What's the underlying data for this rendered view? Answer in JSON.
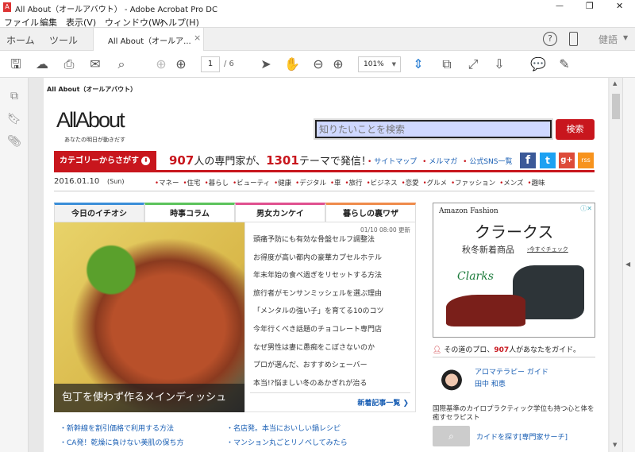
{
  "window": {
    "title": "All About（オールアバウト） - Adobe Acrobat Pro DC",
    "minimize": "—",
    "restore": "❐",
    "close": "✕"
  },
  "menu": [
    "ファイル",
    "編集",
    "表示(V)",
    "ウィンドウ(W)",
    "ヘルプ(H)"
  ],
  "tabs": {
    "home": "ホーム",
    "tools": "ツール",
    "doc": "All About（オールア...",
    "close": "×",
    "lang": "健語"
  },
  "toolbar": {
    "page_current": "1",
    "page_total": "/ 6",
    "zoom": "101%"
  },
  "page": {
    "header_text": "All About（オールアバウト）",
    "logo": "AllAbout",
    "tagline": "あなたの明日が動きだす",
    "search_placeholder": "知りたいことを検索",
    "search_button": "検索",
    "category_button": "カテゴリーからさがす",
    "experts_count": "907",
    "experts_text": "人の専門家が、",
    "themes_count": "1301",
    "themes_text": "テーマで発信！",
    "links": [
      "サイトマップ",
      "メルマガ",
      "公式SNS一覧"
    ],
    "social": [
      "f",
      "t",
      "g+",
      "rss"
    ],
    "date": "2016.01.10",
    "day": "(Sun)",
    "categories": [
      "マネー",
      "住宅",
      "暮らし",
      "ビューティ",
      "健康",
      "デジタル",
      "車",
      "旅行",
      "ビジネス",
      "恋愛",
      "グルメ",
      "ファッション",
      "メンズ",
      "趣味"
    ],
    "section_tabs": [
      {
        "label": "今日のイチオシ",
        "color": "#3a8ed8"
      },
      {
        "label": "時事コラム",
        "color": "#5cc35c"
      },
      {
        "label": "男女カンケイ",
        "color": "#e0508f"
      },
      {
        "label": "暮らしの裏ワザ",
        "color": "#ef8b4b"
      }
    ],
    "feature_caption": "包丁を使わず作るメインディッシュ",
    "updated": "01/10 08:00 更新",
    "headlines": [
      "頭痛予防にも有効な骨盤セルフ調整法",
      "お得度が高い都内の豪華カプセルホテル",
      "年末年始の食べ過ぎをリセットする方法",
      "旅行者がモンサンミッシェルを選ぶ理由",
      "「メンタルの強い子」を育てる10のコツ",
      "今年行くべき話題のチョコレート専門店",
      "なぜ男性は妻に愚痴をこぼさないのか",
      "プロが選んだ、おすすめシェーバー",
      "本当!?悩ましい冬のあかぎれが治る"
    ],
    "more_articles": "新着記事一覧 ❯",
    "bottom_links": [
      "新幹線を割引価格で利用する方法",
      "名店発。本当においしい鍋レシピ",
      "CA発！乾燥に負けない美肌の保ち方",
      "マンション丸ごとリノベしてみたら"
    ],
    "ad": {
      "brand": "Amazon Fashion",
      "title": "クラークス",
      "subtitle": "秋冬新着商品",
      "cta": "›今すぐチェック",
      "logo": "Clarks"
    },
    "guide_count": "907",
    "guide_pre": "その道のプロ、",
    "guide_post": "人があなたをガイド。",
    "guide": {
      "topic": "アロマテラピー ガイド",
      "name": "田中 和恵",
      "desc": "国際基準のカイロプラクティック学位も持つ心と体を癒すセラピスト",
      "search": "カイドを探す[専門家サーチ]"
    }
  }
}
